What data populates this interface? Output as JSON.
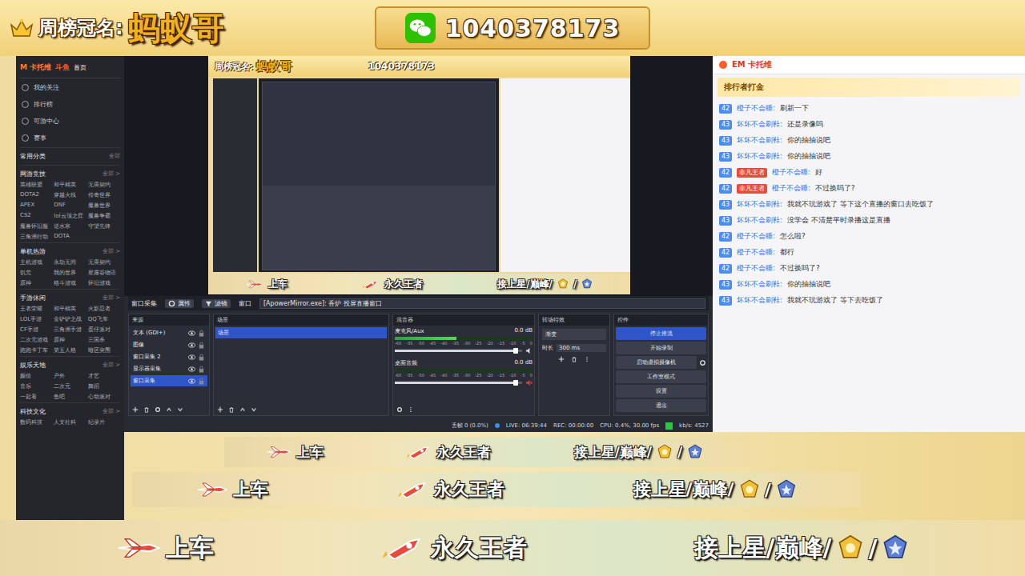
{
  "banner": {
    "sponsor_label": "周榜冠名:",
    "sponsor_name": "蚂蚁哥",
    "wechat": "1040378173"
  },
  "sidebar": {
    "brand": "M 卡托维",
    "platform": "斗鱼",
    "home": "首页",
    "nav": [
      "我的关注",
      "排行榜",
      "可游中心",
      "赛事"
    ],
    "sections": [
      {
        "title": "常用分类",
        "more": "全部",
        "items": []
      },
      {
        "title": "网游竞技",
        "more": "全部 >",
        "items": [
          "英雄联盟",
          "和平精英",
          "无畏契约",
          "DOTA2",
          "穿越火线",
          "传奇世界",
          "APEX",
          "DNF",
          "魔兽世界",
          "CS2",
          "lol云顶之弈",
          "魔兽争霸",
          "魔兽怀旧服",
          "逆水寒",
          "守望先锋",
          "三角洲行动",
          "DOTA"
        ]
      },
      {
        "title": "单机热游",
        "more": "全部 >",
        "items": [
          "主机游戏",
          "永劫无间",
          "无畏契约",
          "饥荒",
          "我的世界",
          "星露谷物语",
          "原神",
          "格斗游戏",
          "怀旧游戏"
        ]
      },
      {
        "title": "手游休闲",
        "more": "全部 >",
        "items": [
          "王者荣耀",
          "和平精英",
          "火影忍者",
          "LOL手游",
          "金铲铲之战",
          "QQ飞车",
          "CF手游",
          "三角洲手游",
          "蛋仔派对",
          "二次元游戏",
          "原神",
          "三国杀",
          "跑跑卡丁车",
          "第五人格",
          "暗区突围"
        ]
      },
      {
        "title": "娱乐天地",
        "more": "全部 >",
        "items": [
          "颜值",
          "户外",
          "才艺",
          "音乐",
          "二次元",
          "舞蹈",
          "一起看",
          "鱼吧",
          "心动派对"
        ]
      },
      {
        "title": "科技文化",
        "more": "全部 >",
        "items": [
          "数码科技",
          "人文社科",
          "纪录片"
        ]
      }
    ]
  },
  "obs": {
    "toolbar": {
      "source": "窗口采集",
      "properties": "属性",
      "filters": "滤镜",
      "window_label": "窗口",
      "window_value": "[ApowerMirror.exe]: 香炉 投屏直播窗口"
    },
    "sources": {
      "title": "来源",
      "items": [
        {
          "label": "文本 (GDI+)",
          "visible": true,
          "locked": false,
          "selected": false
        },
        {
          "label": "图像",
          "visible": true,
          "locked": false,
          "selected": false
        },
        {
          "label": "窗口采集 2",
          "visible": true,
          "locked": false,
          "selected": false
        },
        {
          "label": "显示器采集",
          "visible": true,
          "locked": false,
          "selected": false
        },
        {
          "label": "窗口采集",
          "visible": true,
          "locked": false,
          "selected": true
        }
      ]
    },
    "scenes": {
      "title": "场景",
      "items": [
        {
          "label": "场景",
          "selected": true
        }
      ]
    },
    "mixer": {
      "title": "混音器",
      "scale": [
        "-60",
        "-55",
        "-50",
        "-45",
        "-40",
        "-35",
        "-30",
        "-25",
        "-20",
        "-15",
        "-10",
        "-5",
        "0"
      ],
      "channels": [
        {
          "name": "麦克风/Aux",
          "reading": "0.0 dB",
          "level": 0.45,
          "volume": 0.95,
          "muted": false
        },
        {
          "name": "桌面音频",
          "reading": "0.0 dB",
          "level": 0,
          "volume": 0.95,
          "muted": true
        }
      ]
    },
    "transitions": {
      "title": "转场特效",
      "value": "渐变",
      "duration_label": "时长",
      "duration": "300 ms"
    },
    "controls": {
      "title": "控件",
      "buttons": [
        {
          "label": "停止推流",
          "selected": true
        },
        {
          "label": "开始录制",
          "selected": false
        },
        {
          "label": "启动虚拟摄像机",
          "selected": false
        },
        {
          "label": "工作室模式",
          "selected": false
        },
        {
          "label": "设置",
          "selected": false
        },
        {
          "label": "退出",
          "selected": false
        }
      ]
    },
    "status": {
      "dropped": "丢帧 0 (0.0%)",
      "live": "LIVE: 06:39:44",
      "rec": "REC: 00:00:00",
      "cpu": "CPU: 0.4%, 30.00 fps",
      "bitrate": "kb/s: 4527"
    }
  },
  "chat": {
    "header": "EM 卡托维",
    "rank_title": "排行者打金",
    "messages": [
      {
        "lv": "42",
        "name": "橙子不会睡",
        "tag": "",
        "text": "刷新一下"
      },
      {
        "lv": "43",
        "name": "坏坏不会刷鞋",
        "tag": "",
        "text": "还是录像吗"
      },
      {
        "lv": "43",
        "name": "坏坏不会刷鞋",
        "tag": "",
        "text": "你的抽抽说吧"
      },
      {
        "lv": "43",
        "name": "坏坏不会刷鞋",
        "tag": "",
        "text": "你的抽抽说吧"
      },
      {
        "lv": "42",
        "name": "橙子不会睡",
        "tag": "非凡王者",
        "text": "好"
      },
      {
        "lv": "42",
        "name": "橙子不会睡",
        "tag": "非凡王者",
        "text": "不过换吗了?"
      },
      {
        "lv": "43",
        "name": "坏坏不会刷鞋",
        "tag": "",
        "text": "我就不玩游戏了 等下这个直播的窗口去吃饭了"
      },
      {
        "lv": "43",
        "name": "坏坏不会刷鞋",
        "tag": "",
        "text": "没学会 不清楚平时录播这是直播"
      },
      {
        "lv": "42",
        "name": "橙子不会睡",
        "tag": "",
        "text": "怎么啦?"
      },
      {
        "lv": "42",
        "name": "橙子不会睡",
        "tag": "",
        "text": "都行"
      },
      {
        "lv": "42",
        "name": "橙子不会睡",
        "tag": "",
        "text": "不过换吗了?"
      },
      {
        "lv": "43",
        "name": "坏坏不会刷鞋",
        "tag": "",
        "text": "你的抽抽说吧"
      },
      {
        "lv": "43",
        "name": "坏坏不会刷鞋",
        "tag": "",
        "text": "我就不玩游戏了 等下去吃饭了"
      }
    ]
  },
  "ticker": {
    "items": [
      {
        "label": "上车",
        "kind": "plane"
      },
      {
        "label": "永久王者",
        "kind": "rocket"
      },
      {
        "label": "接上星/巅峰/",
        "kind": "badges"
      }
    ],
    "badge_separator": "/"
  }
}
